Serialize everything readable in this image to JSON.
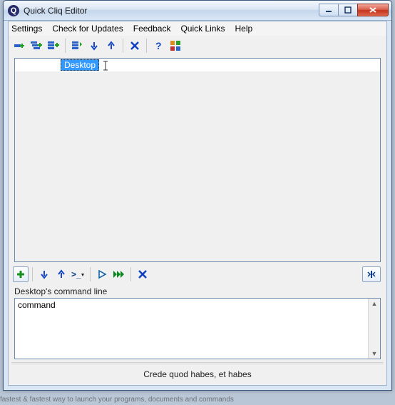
{
  "window": {
    "title": "Quick Cliq Editor"
  },
  "menu": {
    "settings": "Settings",
    "updates": "Check for Updates",
    "feedback": "Feedback",
    "quicklinks": "Quick Links",
    "help": "Help"
  },
  "tree": {
    "selected_item": "Desktop"
  },
  "command": {
    "label": "Desktop's command line",
    "value": "command"
  },
  "footer": {
    "motto": "Crede quod habes, et habes"
  },
  "background_strip": "fastest & fastest way to launch your programs, documents and commands"
}
